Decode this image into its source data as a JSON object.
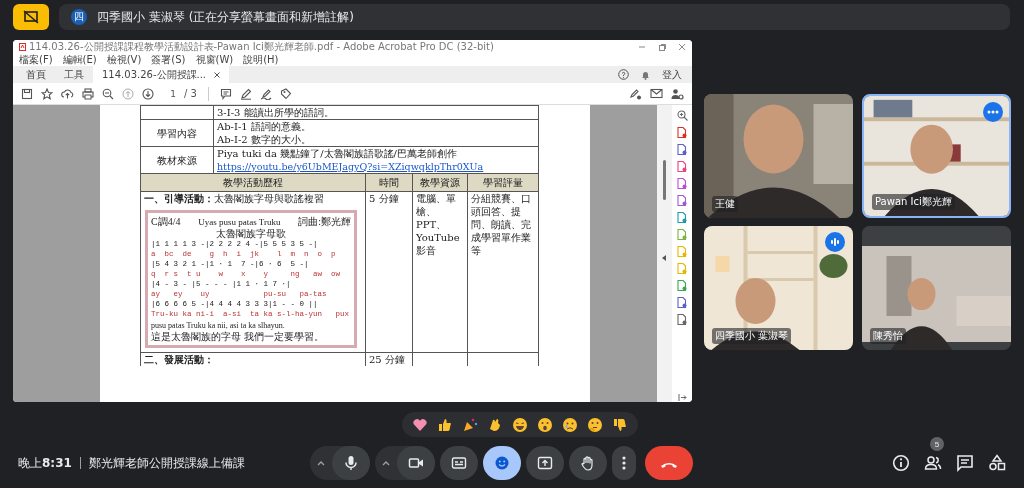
{
  "share_banner": {
    "avatar": "四",
    "text": "四季國小 葉淑琴 (正在分享螢幕畫面和新增註解)"
  },
  "acrobat": {
    "title": "114.03.26-公開授課課程教學活動設計表-Pawan Ici鄭光輝老師.pdf - Adobe Acrobat Pro DC (32-bit)",
    "menu": [
      "檔案(F)",
      "編輯(E)",
      "檢視(V)",
      "簽署(S)",
      "視窗(W)",
      "說明(H)"
    ],
    "tabs": [
      {
        "label": "首頁",
        "selected": false
      },
      {
        "label": "工具",
        "selected": false
      },
      {
        "label": "114.03.26-公開授課...",
        "selected": true
      }
    ],
    "sign_in": "登入",
    "page_number": "1",
    "page_total": "/ 3"
  },
  "document": {
    "info_rows": [
      {
        "lines": [
          "3-I-3 能讀出所學的語詞。"
        ]
      },
      {
        "label": "學習內容",
        "lines": [
          "Ab-Ⅰ-1 語詞的意義。",
          "Ab-Ⅰ-2 數字的大小。"
        ]
      },
      {
        "label": "教材來源",
        "lines": [
          "Piya tuki da 幾點鐘了/太魯閣族語歌謠/巴萬老師創作"
        ],
        "link": "https://youtu.be/y6UbMEJagyQ?si=XZiqwqklpThr0XUa"
      }
    ],
    "columns": [
      "教學活動歷程",
      "時間",
      "教學資源",
      "學習評量"
    ],
    "activities": [
      {
        "heading": "**一、引導活動：**太魯閣族字母與歌謠複習",
        "bold": false,
        "time": "5 分鐘",
        "resources": "電腦、單槍、PPT、YouTube 影音",
        "assessment": "分組競賽、口頭回答、提問、朗讀、完成學習單作業等",
        "notation": {
          "key": "C調4/4",
          "title": "Uyas pusu patas Truku",
          "credit": "詞曲:鄭光輝",
          "subtitle": "太魯閣族字母歌",
          "lines": [
            "|1 1 1 1 3 -|2 2 2 2 4 -|5 5 5 3 5 -|",
            "a  bc  de    g  h  i  jk    l  m  n  o  p",
            "|5 4 3 2 1 -|1 · 1  7 -|6 · 6  5 -|",
            "q  r s  t u    w    x    y     ng   aw  ow",
            "|4 - 3 - |5 - - - |1 1 · 1 7 ·|",
            "ay   ey    uy            pu-su   pa-tas",
            "|6 6 6 6 5 -|4 4 4 4 3 3 3|1 - - 0 ||",
            "Tru-ku ka ni-i  a-si  ta ka s-l-ha-yun   pux"
          ],
          "footer": [
            "pusu patas Truku ka nii, asi ta ka slhayun.",
            "這是太魯閣族的字母  我們一定要學習。"
          ]
        }
      },
      {
        "heading": "二、發展活動：",
        "bold": true,
        "time": "25 分鐘"
      }
    ]
  },
  "participants": [
    {
      "name": "王健",
      "highlighted": false,
      "speaking": false
    },
    {
      "name": "Pawan Ici鄭光輝",
      "highlighted": true,
      "speaking": false
    },
    {
      "name": "四季國小 葉淑琴",
      "highlighted": false,
      "speaking": true
    },
    {
      "name": "陳秀怡",
      "highlighted": false,
      "speaking": false
    }
  ],
  "bottom_bar": {
    "clock": "晚上**8:31**",
    "meeting_title": "鄭光輝老師公開授課線上備課",
    "reactions_open": true,
    "people_count": "5"
  }
}
